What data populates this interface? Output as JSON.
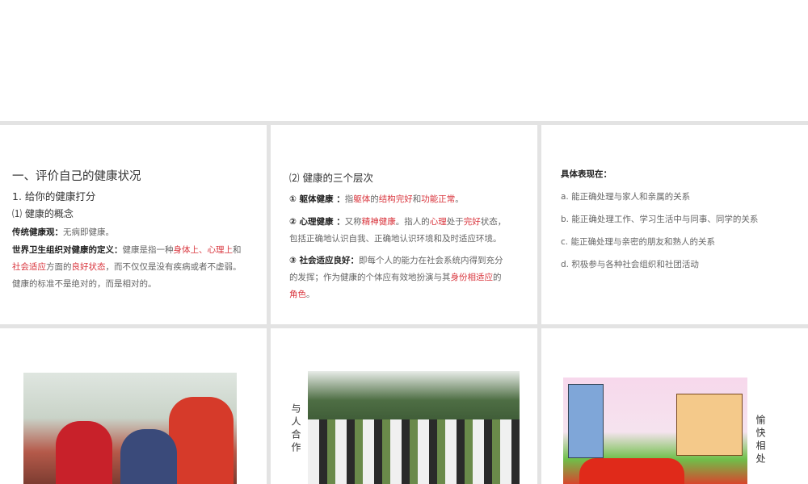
{
  "slide1": {
    "title": "一、评价自己的健康状况",
    "subtitle": "1. 给你的健康打分",
    "section": "⑴ 健康的概念",
    "traditional_label": "传统健康观：",
    "traditional_text": "无病即健康。",
    "who_label": "世界卫生组织对健康的定义：",
    "who_segments": [
      "健康是指一种",
      "身体上、心理上",
      "和"
    ],
    "line2_segments": [
      "社会适应",
      "方面的",
      "良好状态",
      "，而不仅仅是没有疾病或者不虚弱。"
    ],
    "line3": "健康的标准不是绝对的，而是相对的。"
  },
  "slide2": {
    "title": "⑵ 健康的三个层次",
    "item1": [
      "① 躯体健康 ：",
      "指",
      "躯体",
      "的",
      "结构完好",
      "和",
      "功能正常",
      "。"
    ],
    "item2a": [
      "② 心理健康 ：",
      "又称",
      "精神健康",
      "。指人的",
      "心理",
      "处于",
      "完好",
      "状态，"
    ],
    "item2b": "包括正确地认识自我、正确地认识环境和及时适应环境。",
    "item3a": [
      "③ 社会适应良好：",
      "即每个人的能力在社会系统内得到充分"
    ],
    "item3b": [
      "的发挥；作为健康的个体应有效地扮演与其",
      "身份相适应",
      "的"
    ],
    "item3c": [
      "角色",
      "。"
    ]
  },
  "slide3": {
    "title": "具体表现在：",
    "items": [
      "a. 能正确处理与家人和亲属的关系",
      "b. 能正确处理工作、学习生活中与同事、同学的关系",
      "c. 能正确处理与亲密的朋友和熟人的关系",
      "d. 积极参与各种社会组织和社团活动"
    ]
  },
  "slide5": {
    "caption": "与人合作"
  },
  "slide6": {
    "caption": "愉快相处"
  }
}
